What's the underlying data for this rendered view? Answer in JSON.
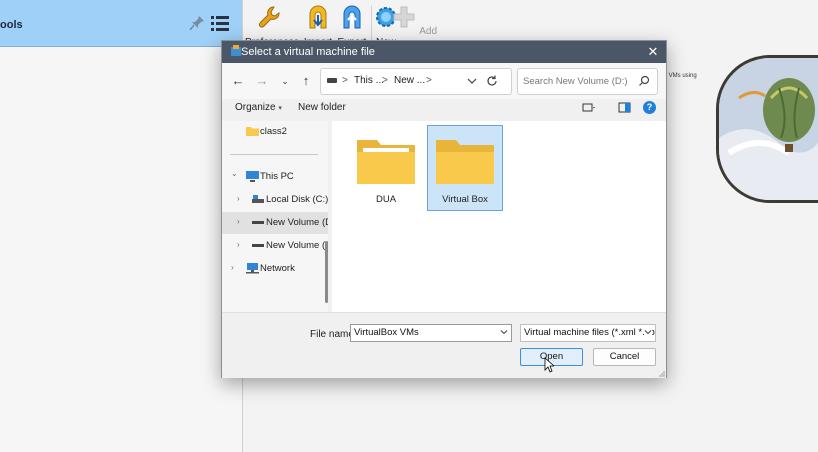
{
  "background_app": {
    "tools_label": "ools",
    "toolbar": [
      {
        "label": "Preferences",
        "icon": "wrench-icon"
      },
      {
        "label": "Import",
        "icon": "import-arrow-icon"
      },
      {
        "label": "Export",
        "icon": "export-arrow-icon"
      },
      {
        "label": "New",
        "icon": "new-gear-icon"
      },
      {
        "label": "Add",
        "icon": "add-plus-icon"
      }
    ],
    "hint_text": "v VMs using"
  },
  "dialog": {
    "title": "Select a virtual machine file",
    "close_glyph": "✕",
    "address": {
      "segments": [
        "This ...",
        "New ..."
      ],
      "separator": ">"
    },
    "search_placeholder": "Search New Volume (D:)",
    "commands": {
      "organize": "Organize",
      "organize_caret": "▾",
      "new_folder": "New folder"
    },
    "nav_tree": [
      {
        "label": "class2",
        "icon": "folder-icon",
        "level": 1,
        "arrow": ""
      },
      {
        "label": "This PC",
        "icon": "computer-icon",
        "level": 0,
        "arrow": "⌄"
      },
      {
        "label": "Local Disk (C:)",
        "icon": "drive-icon",
        "level": 1,
        "arrow": "›"
      },
      {
        "label": "New Volume (D",
        "icon": "drive-icon",
        "level": 1,
        "arrow": "›",
        "selected": true
      },
      {
        "label": "New Volume (E",
        "icon": "drive-icon",
        "level": 1,
        "arrow": "›"
      },
      {
        "label": "Network",
        "icon": "network-icon",
        "level": 0,
        "arrow": "›"
      }
    ],
    "folders": [
      {
        "label": "DUA",
        "selected": false
      },
      {
        "label": "Virtual Box",
        "selected": true
      }
    ],
    "file_name_label": "File name:",
    "file_name_value": "VirtualBox VMs",
    "file_type_value": "Virtual machine files (*.xml *.vbox)",
    "open_button": "Open",
    "cancel_button": "Cancel"
  },
  "colors": {
    "title_bar": "#4b5766",
    "accent": "#1f7fd9",
    "selection": "#cce4f7",
    "folder_yellow": "#f8c94a"
  }
}
